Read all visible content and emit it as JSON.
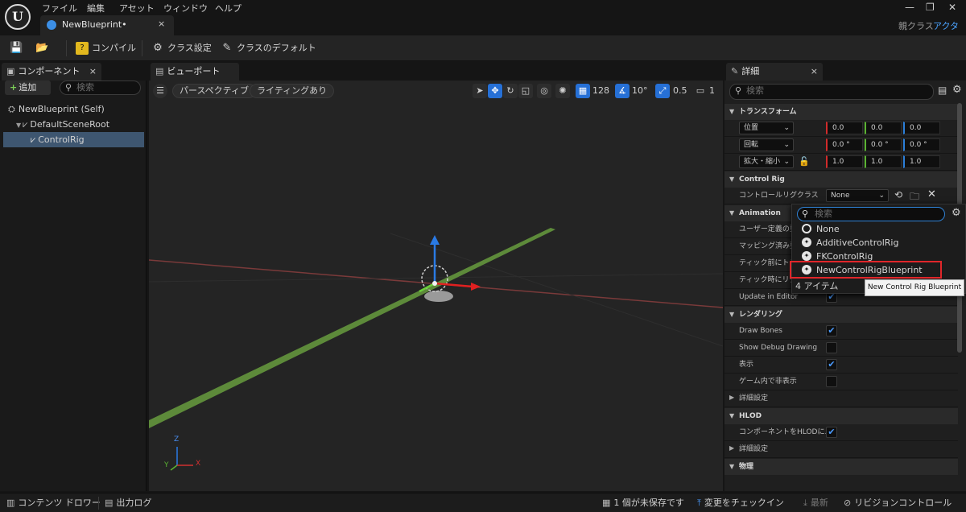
{
  "menu": [
    "ファイル",
    "編集",
    "アセット",
    "ウィンドウ",
    "ヘルプ"
  ],
  "tab": {
    "label": "NewBlueprint•",
    "close": "×"
  },
  "window_controls": [
    "—",
    "❐",
    "✕"
  ],
  "parent_class": {
    "label": "親クラス",
    "value": "アクタ"
  },
  "toolbar": {
    "compile": "コンパイル",
    "class_settings": "クラス設定",
    "class_defaults": "クラスのデフォルト"
  },
  "components": {
    "title": "コンポーネント",
    "close": "×",
    "add": "追加",
    "search_placeholder": "検索",
    "tree": [
      {
        "label": "NewBlueprint (Self)"
      },
      {
        "label": "DefaultSceneRoot"
      },
      {
        "label": "ControlRig"
      }
    ]
  },
  "viewport": {
    "title": "ビューポート",
    "close": "×",
    "perspective": "パースペクティブ",
    "lighting": "ライティングあり",
    "grid_size": "128",
    "rotation_snap": "10°",
    "scale_snap": "0.5",
    "camera_speed": "1",
    "axis": {
      "z": "Z",
      "y": "Y",
      "x": "X"
    }
  },
  "details": {
    "title": "詳細",
    "close": "×",
    "search_placeholder": "検索",
    "transform": {
      "section": "トランスフォーム",
      "location": {
        "label": "位置",
        "values": [
          "0.0",
          "0.0",
          "0.0"
        ]
      },
      "rotation": {
        "label": "回転",
        "values": [
          "0.0 °",
          "0.0 °",
          "0.0 °"
        ]
      },
      "scale": {
        "label": "拡大・縮小",
        "values": [
          "1.0",
          "1.0",
          "1.0"
        ]
      }
    },
    "control_rig": {
      "section": "Control Rig",
      "class_label": "コントロールリグクラス",
      "class_value": "None"
    },
    "animation": {
      "section": "Animation",
      "rows": [
        "ユーザー定義の要",
        "マッピング済み要",
        "ティック前にトラン",
        "ティック時にリグを",
        "Update in Editor"
      ]
    },
    "rendering": {
      "section": "レンダリング",
      "rows": [
        "Draw Bones",
        "Show Debug Drawing",
        "表示",
        "ゲーム内で非表示"
      ],
      "advanced": "詳細設定"
    },
    "hlod": {
      "section": "HLOD",
      "row": "コンポーネントをHLODに...",
      "advanced": "詳細設定"
    },
    "physics": {
      "section": "物理"
    }
  },
  "picker": {
    "search_placeholder": "検索",
    "options": [
      "None",
      "AdditiveControlRig",
      "FKControlRig",
      "NewControlRigBlueprint"
    ],
    "count": "4 アイテム",
    "tooltip": "New Control Rig Blueprint"
  },
  "status": {
    "content_drawer": "コンテンツ ドロワー",
    "output_log": "出力ログ",
    "unsaved": "1 個が未保存です",
    "checkin": "変更をチェックイン",
    "latest": "最新",
    "revision": "リビジョンコントロール"
  }
}
